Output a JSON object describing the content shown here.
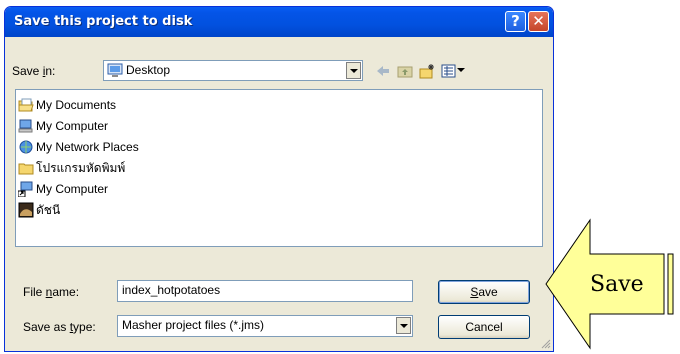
{
  "dialog": {
    "title": "Save this project to disk",
    "help_icon": "?",
    "close_icon": "✕"
  },
  "save_in": {
    "label_pre": "Save ",
    "label_u": "i",
    "label_post": "n:",
    "value": "Desktop",
    "icon": "desktop-icon"
  },
  "toolbar": {
    "icons": [
      "back-arrow-icon",
      "up-folder-icon",
      "new-folder-icon",
      "view-menu-icon"
    ]
  },
  "files": [
    {
      "name": "My Documents",
      "icon": "folder-open-icon"
    },
    {
      "name": "My Computer",
      "icon": "computer-icon"
    },
    {
      "name": "My Network Places",
      "icon": "network-icon"
    },
    {
      "name": "โปรแกรมหัดพิมพ์",
      "icon": "folder-icon"
    },
    {
      "name": "My Computer",
      "icon": "computer-shortcut-icon"
    },
    {
      "name": "ดัชนี",
      "icon": "image-file-icon"
    }
  ],
  "file_name": {
    "label_pre": "File ",
    "label_u": "n",
    "label_post": "ame:",
    "value": "index_hotpotatoes"
  },
  "save_as_type": {
    "label_pre": "Save as ",
    "label_u": "t",
    "label_post": "ype:",
    "value": "Masher project files (*.jms)"
  },
  "buttons": {
    "save_u": "S",
    "save_rest": "ave",
    "cancel": "Cancel"
  },
  "callout": {
    "label": "Save",
    "color": "#ffff99"
  }
}
